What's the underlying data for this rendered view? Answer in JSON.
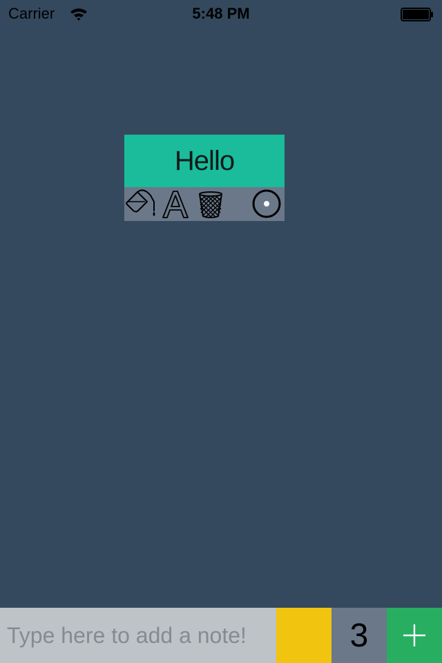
{
  "status_bar": {
    "carrier": "Carrier",
    "time": "5:48 PM",
    "wifi_icon": "wifi-icon",
    "battery_icon": "battery-icon"
  },
  "note": {
    "text": "Hello",
    "background_color": "#1abc9c",
    "toolbar": {
      "icons": [
        "paint-bucket-icon",
        "font-icon",
        "trash-icon",
        "drag-handle-icon"
      ]
    }
  },
  "input_bar": {
    "placeholder": "Type here to add a note!",
    "value": "",
    "selected_color": "#f1c40f",
    "note_count": "3",
    "add_icon": "plus-icon",
    "add_button_color": "#27ae60"
  },
  "colors": {
    "background": "#34495e",
    "toolbar": "#6b7889",
    "input_background": "#bdc3c7"
  }
}
